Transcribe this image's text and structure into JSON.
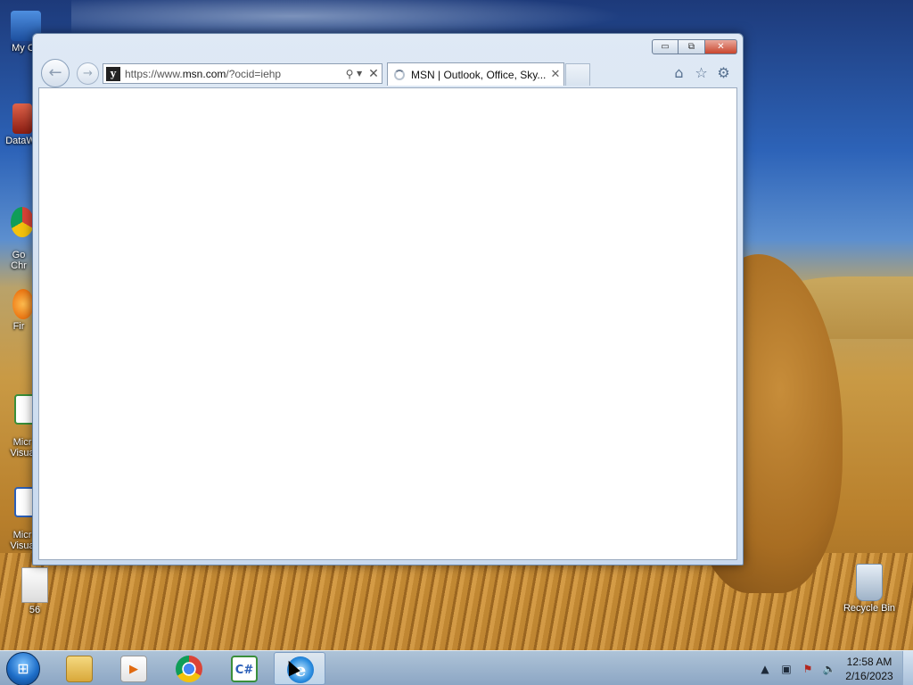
{
  "desktop": {
    "icons": [
      {
        "label": "My Co",
        "icon": "computer-icon"
      },
      {
        "label": "DataW",
        "icon": "datawarehouse-icon"
      },
      {
        "label": "Go\nChr",
        "icon": "chrome-icon"
      },
      {
        "label": "Fir",
        "icon": "firefox-icon"
      },
      {
        "label": "Micr\nVisua",
        "icon": "visual-studio-icon"
      },
      {
        "label": "Micr\nVisua",
        "icon": "visual-studio-icon"
      },
      {
        "label": "56",
        "icon": "text-file-icon"
      },
      {
        "label": "Recycle Bin",
        "icon": "recycle-bin-icon"
      }
    ]
  },
  "browser": {
    "address": {
      "prefix": "https://www.",
      "domain": "msn.com",
      "suffix": "/?ocid=iehp"
    },
    "tab": {
      "title": "MSN | Outlook, Office, Sky...",
      "close": "✕"
    },
    "window_controls": {
      "minimize": "▭",
      "maximize": "⧉",
      "close": "✕"
    }
  },
  "taskbar": {
    "apps": [
      {
        "name": "file-explorer",
        "icon": "folder-icon"
      },
      {
        "name": "media-player",
        "icon": "media-player-icon"
      },
      {
        "name": "chrome",
        "icon": "chrome-icon"
      },
      {
        "name": "csharp",
        "icon": "csharp-icon",
        "label": "C#"
      },
      {
        "name": "internet-explorer",
        "icon": "ie-icon",
        "active": true
      }
    ],
    "clock": {
      "time": "12:58 AM",
      "date": "2/16/2023"
    }
  }
}
